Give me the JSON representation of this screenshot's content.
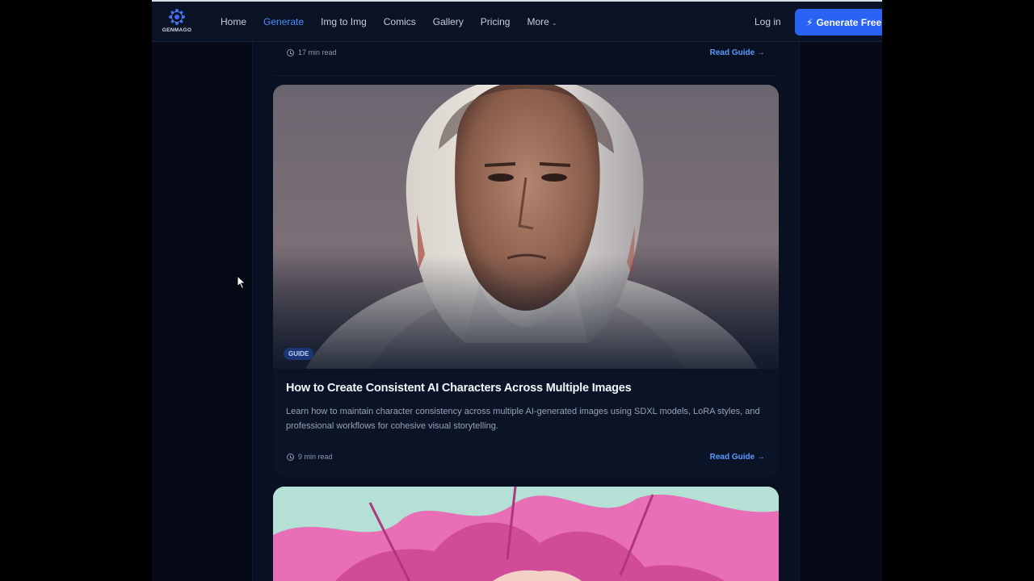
{
  "brand": {
    "name": "GENMAGO"
  },
  "nav": {
    "links": [
      {
        "label": "Home",
        "active": false
      },
      {
        "label": "Generate",
        "active": true
      },
      {
        "label": "Img to Img",
        "active": false
      },
      {
        "label": "Comics",
        "active": false
      },
      {
        "label": "Gallery",
        "active": false
      },
      {
        "label": "Pricing",
        "active": false
      },
      {
        "label": "More",
        "active": false
      }
    ],
    "login_label": "Log in",
    "cta_label": "Generate Free"
  },
  "previous_card": {
    "read_time": "17 min read",
    "link_label": "Read Guide →"
  },
  "card": {
    "tag": "GUIDE",
    "title": "How to Create Consistent AI Characters Across Multiple Images",
    "description": "Learn how to maintain character consistency across multiple AI-generated images using SDXL models, LoRA styles, and professional workflows for cohesive visual storytelling.",
    "read_time": "9 min read",
    "link_label": "Read Guide →",
    "image_subject": "portrait-man-white-hood"
  },
  "next_card": {
    "image_subject": "illustration-pink-hair"
  },
  "colors": {
    "accent": "#2a62f3",
    "active_link": "#4d8dff",
    "page_bg": "#050a16"
  },
  "icons": [
    "genmago-logo-icon",
    "chevron-down-icon",
    "bolt-icon",
    "clock-icon",
    "mouse-cursor-icon"
  ]
}
